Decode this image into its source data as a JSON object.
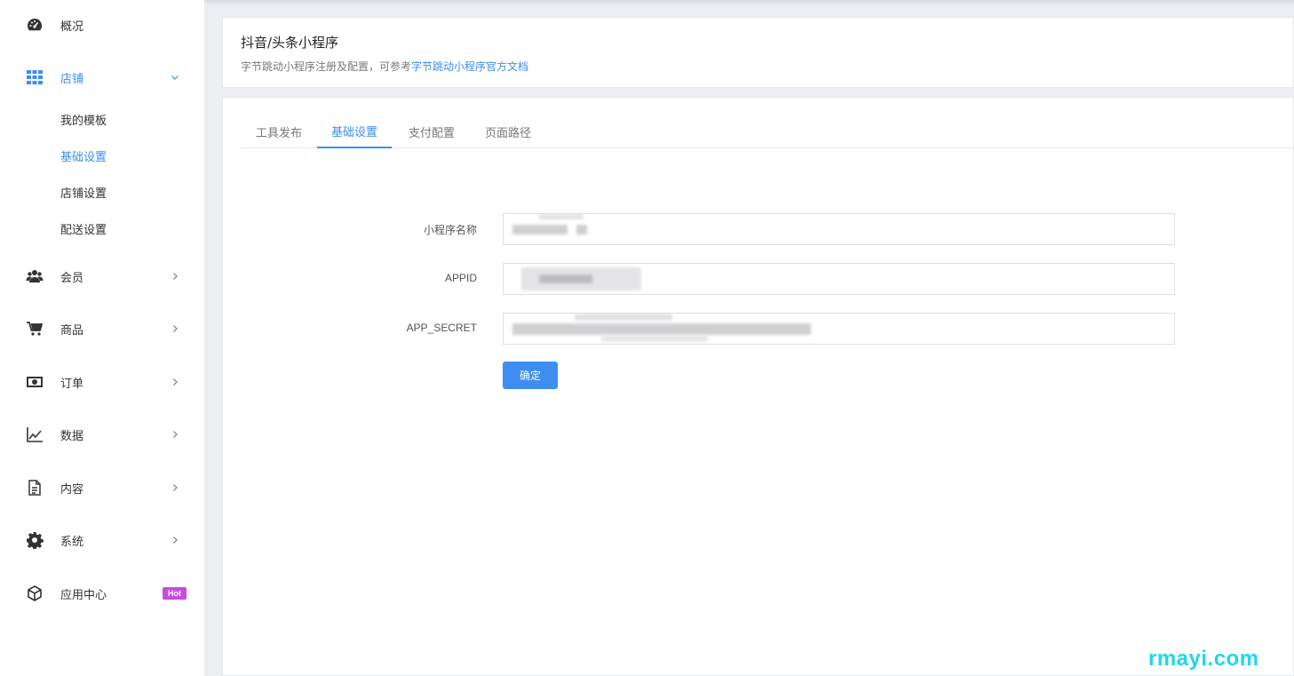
{
  "sidebar": {
    "items": [
      {
        "label": "概况",
        "icon": "dashboard-icon"
      },
      {
        "label": "店铺",
        "icon": "grid-icon"
      },
      {
        "label": "会员",
        "icon": "users-icon"
      },
      {
        "label": "商品",
        "icon": "cart-icon"
      },
      {
        "label": "订单",
        "icon": "money-icon"
      },
      {
        "label": "数据",
        "icon": "chart-icon"
      },
      {
        "label": "内容",
        "icon": "document-icon"
      },
      {
        "label": "系统",
        "icon": "gear-icon"
      },
      {
        "label": "应用中心",
        "icon": "cube-icon"
      }
    ],
    "store_submenu": [
      "我的模板",
      "基础设置",
      "店铺设置",
      "配送设置"
    ],
    "hot_badge": "Hot"
  },
  "header": {
    "title": "抖音/头条小程序",
    "desc_prefix": "字节跳动小程序注册及配置，可参考",
    "desc_link": "字节跳动小程序官方文档"
  },
  "tabs": [
    "工具发布",
    "基础设置",
    "支付配置",
    "页面路径"
  ],
  "active_tab": "基础设置",
  "form": {
    "name_label": "小程序名称",
    "appid_label": "APPID",
    "secret_label": "APP_SECRET",
    "confirm_label": "确定"
  },
  "watermark": "rmayi.com",
  "colors": {
    "accent": "#3d8ef0",
    "hot_badge": "#c64cde",
    "watermark": "#22d6e8"
  }
}
